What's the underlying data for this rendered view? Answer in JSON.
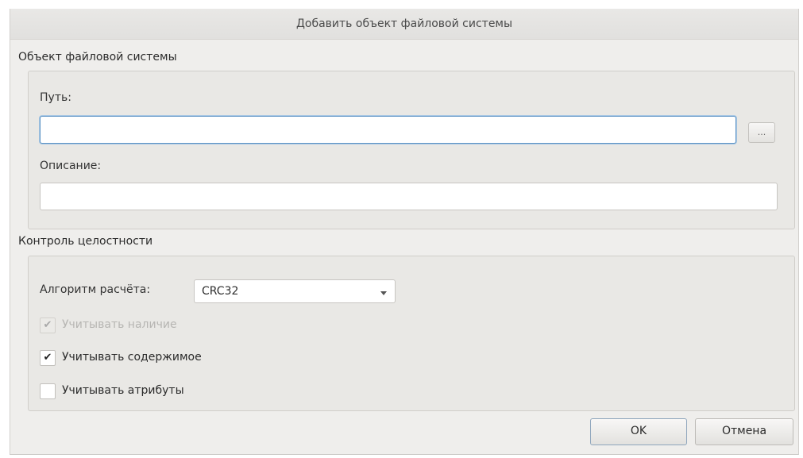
{
  "dialog": {
    "title": "Добавить объект файловой системы"
  },
  "fs_object": {
    "section_title": "Объект файловой системы",
    "path_label": "Путь:",
    "path_value": "",
    "browse_label": "...",
    "description_label": "Описание:",
    "description_value": ""
  },
  "integrity": {
    "section_title": "Контроль целостности",
    "algorithm_label": "Алгоритм расчёта:",
    "algorithm_value": "CRC32",
    "checkboxes": [
      {
        "label": "Учитывать наличие",
        "checked": true,
        "enabled": false
      },
      {
        "label": "Учитывать содержимое",
        "checked": true,
        "enabled": true
      },
      {
        "label": "Учитывать атрибуты",
        "checked": false,
        "enabled": true
      }
    ]
  },
  "buttons": {
    "ok_label": "OK",
    "cancel_label": "Отмена"
  }
}
